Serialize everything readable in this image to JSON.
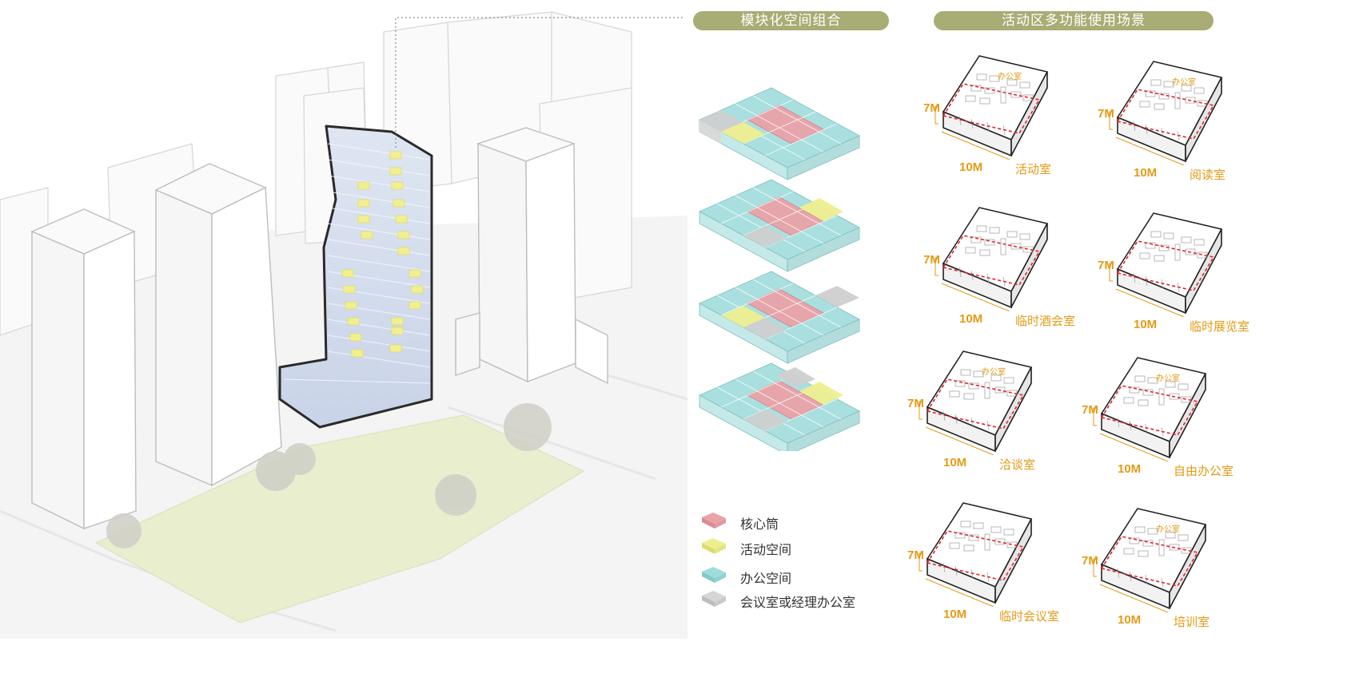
{
  "headers": {
    "modular": "模块化空间组合",
    "scenarios": "活动区多功能使用场景"
  },
  "legend": {
    "core": "核心筒",
    "activity": "活动空间",
    "office": "办公空间",
    "meeting": "会议室或经理办公室"
  },
  "colors": {
    "core": "#e9a3a8",
    "activity": "#eeee8f",
    "office": "#9fdddc",
    "meeting": "#cfcfcf",
    "accent": "#e39a14",
    "header": "#a9ac74",
    "dash": "#e0242b"
  },
  "scenarios": [
    {
      "name": "活动室",
      "width": "10M",
      "depth": "7M",
      "office": "办公室"
    },
    {
      "name": "阅读室",
      "width": "10M",
      "depth": "7M",
      "office": "办公室"
    },
    {
      "name": "临时酒会室",
      "width": "10M",
      "depth": "7M",
      "office": ""
    },
    {
      "name": "临时展览室",
      "width": "10M",
      "depth": "7M",
      "office": ""
    },
    {
      "name": "洽谈室",
      "width": "10M",
      "depth": "7M",
      "office": "办公室"
    },
    {
      "name": "自由办公室",
      "width": "10M",
      "depth": "7M",
      "office": "办公室"
    },
    {
      "name": "临时会议室",
      "width": "10M",
      "depth": "7M",
      "office": ""
    },
    {
      "name": "培训室",
      "width": "10M",
      "depth": "7M",
      "office": "办公室"
    }
  ]
}
